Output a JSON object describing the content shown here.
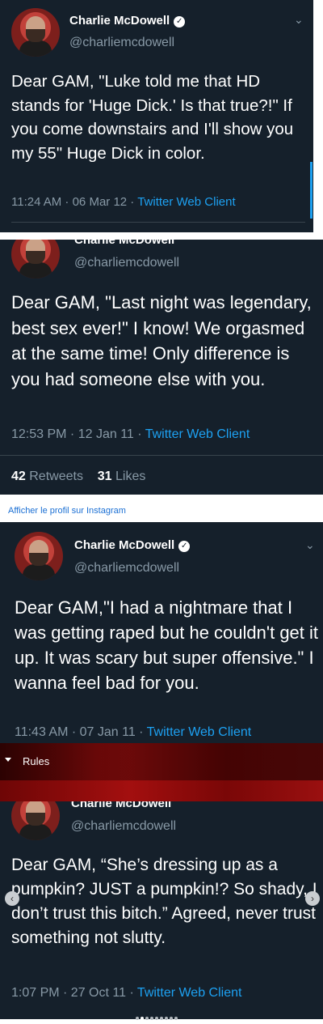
{
  "tweets": [
    {
      "name": "Charlie McDowell",
      "handle": "@charliemcdowell",
      "text": "Dear GAM, \"Luke told me that HD stands for 'Huge Dick.' Is that true?!\" If you come downstairs and I'll show you my 55\" Huge Dick in color.",
      "time": "11:24 AM · 06 Mar 12 · ",
      "client": "Twitter Web Client"
    },
    {
      "name": "Charlie McDowell",
      "handle": "@charliemcdowell",
      "text": "Dear GAM, \"Last night was legendary, best sex ever!\" I know! We orgasmed at the same time! Only difference is you had someone else with you.",
      "time": "12:53 PM · 12 Jan 11 · ",
      "client": "Twitter Web Client",
      "retweets_count": "42",
      "retweets_label": "Retweets",
      "likes_count": "31",
      "likes_label": "Likes"
    },
    {
      "name": "Charlie McDowell",
      "handle": "@charliemcdowell",
      "text": "Dear GAM,\"I had a nightmare that I was getting raped but he couldn't get it up. It was scary but super offensive.\" I wanna feel bad for you.",
      "time": "11:43 AM · 07 Jan 11 · ",
      "client": "Twitter Web Client"
    },
    {
      "name": "Charlie McDowell",
      "handle": "@charliemcdowell",
      "text": "Dear GAM, “She’s dressing up as a pumpkin? JUST a pumpkin!? So shady, I don’t trust this bitch.” Agreed, never trust something not slutty.",
      "time": "1:07 PM · 27 Oct 11 · ",
      "client": "Twitter Web Client"
    }
  ],
  "instagram_link": "Afficher le profil sur Instagram",
  "rules_label": "Rules",
  "icons": {
    "chevron": "chevron-down-icon",
    "verified": "verified-badge-icon",
    "prev": "chevron-left-icon",
    "next": "chevron-right-icon"
  },
  "colors": {
    "tweet_bg": "#15202b",
    "link": "#1da1f2",
    "muted": "#8899a6",
    "rules_bar": "#a30f0f"
  },
  "carousel": {
    "total_dots": 9,
    "active_dot": 1
  }
}
